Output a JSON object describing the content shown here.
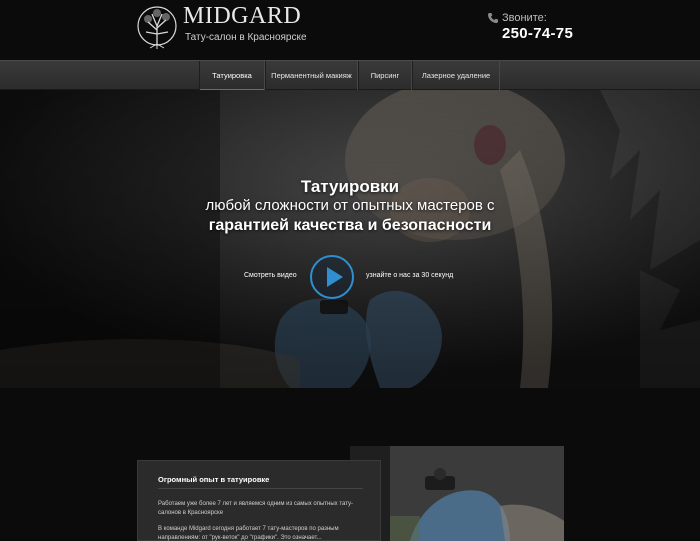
{
  "header": {
    "logo_text": "MIDGARD",
    "tagline": "Тату-салон в Красноярске",
    "call_label": "Звоните:",
    "phone": "250-74-75"
  },
  "nav": {
    "items": [
      {
        "label": "Татуировка",
        "active": true
      },
      {
        "label": "Перманентный макияж",
        "active": false
      },
      {
        "label": "Пирсинг",
        "active": false
      },
      {
        "label": "Лазерное удаление",
        "active": false
      }
    ]
  },
  "hero": {
    "title": "Татуировки",
    "line2": "любой сложности от опытных мастеров с",
    "line3": "гарантией качества и безопасности",
    "watch_label": "Смотреть видео",
    "learn_label": "узнайте о нас за 30 секунд"
  },
  "experience": {
    "title": "Огромный опыт в татуировке",
    "para1": "Работаем уже более 7 лет и являемся одним из самых опытных тату-салонов в Красноярске",
    "para2": "В команде Midgard сегодня работает 7 тату-мастеров по разным направлениям: от \"рук-веток\" до \"графики\". Это означает..."
  },
  "colors": {
    "accent": "#2f8fd0",
    "background": "#0b0b0b",
    "nav_bg": "#333333"
  }
}
